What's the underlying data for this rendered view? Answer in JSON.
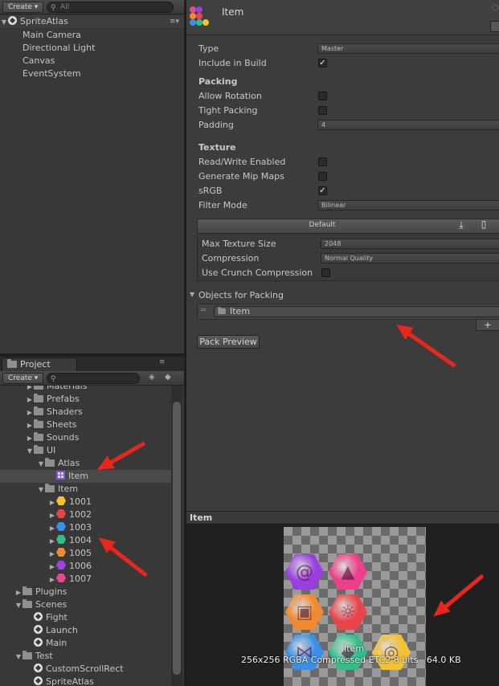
{
  "hierarchy": {
    "create_label": "Create",
    "search_placeholder": "All",
    "scene_name": "SpriteAtlas",
    "items": [
      "Main Camera",
      "Directional Light",
      "Canvas",
      "EventSystem"
    ]
  },
  "project": {
    "tab_label": "Project",
    "create_label": "Create",
    "tree": [
      {
        "label": "Materials",
        "icon": "folder-icon",
        "level": 1,
        "arrow": "collapsed"
      },
      {
        "label": "Prefabs",
        "icon": "folder-icon",
        "level": 1,
        "arrow": "collapsed"
      },
      {
        "label": "Shaders",
        "icon": "folder-icon",
        "level": 1,
        "arrow": "collapsed"
      },
      {
        "label": "Sheets",
        "icon": "folder-icon",
        "level": 1,
        "arrow": "collapsed"
      },
      {
        "label": "Sounds",
        "icon": "folder-icon",
        "level": 1,
        "arrow": "collapsed"
      },
      {
        "label": "UI",
        "icon": "folder-icon",
        "level": 1,
        "arrow": "expanded"
      },
      {
        "label": "Atlas",
        "icon": "folder-icon",
        "level": 2,
        "arrow": "expanded"
      },
      {
        "label": "Item",
        "icon": "sprite-atlas-icon",
        "level": 3,
        "arrow": "none",
        "selected": true
      },
      {
        "label": "Item",
        "icon": "folder-icon",
        "level": 2,
        "arrow": "expanded"
      },
      {
        "label": "1001",
        "icon": "gem-icon",
        "color": "#f2c230",
        "level": 3,
        "arrow": "collapsed"
      },
      {
        "label": "1002",
        "icon": "gem-icon",
        "color": "#e8454a",
        "level": 3,
        "arrow": "collapsed"
      },
      {
        "label": "1003",
        "icon": "gem-icon",
        "color": "#3a8fe8",
        "level": 3,
        "arrow": "collapsed"
      },
      {
        "label": "1004",
        "icon": "gem-icon",
        "color": "#2fc08a",
        "level": 3,
        "arrow": "collapsed"
      },
      {
        "label": "1005",
        "icon": "gem-icon",
        "color": "#f08a30",
        "level": 3,
        "arrow": "collapsed"
      },
      {
        "label": "1006",
        "icon": "gem-icon",
        "color": "#a040e0",
        "level": 3,
        "arrow": "collapsed"
      },
      {
        "label": "1007",
        "icon": "gem-icon",
        "color": "#e84890",
        "level": 3,
        "arrow": "collapsed"
      },
      {
        "label": "Plugins",
        "icon": "folder-icon",
        "level": 0,
        "arrow": "collapsed"
      },
      {
        "label": "Scenes",
        "icon": "folder-icon",
        "level": 0,
        "arrow": "expanded"
      },
      {
        "label": "Fight",
        "icon": "unity-scene-icon",
        "level": 1,
        "arrow": "none"
      },
      {
        "label": "Launch",
        "icon": "unity-scene-icon",
        "level": 1,
        "arrow": "none"
      },
      {
        "label": "Main",
        "icon": "unity-scene-icon",
        "level": 1,
        "arrow": "none"
      },
      {
        "label": "Test",
        "icon": "folder-icon",
        "level": 0,
        "arrow": "expanded"
      },
      {
        "label": "CustomScrollRect",
        "icon": "unity-scene-icon",
        "level": 1,
        "arrow": "none"
      },
      {
        "label": "SpriteAtlas",
        "icon": "unity-scene-icon",
        "level": 1,
        "arrow": "none"
      }
    ]
  },
  "inspector": {
    "title": "Item",
    "type_label": "Type",
    "type_value": "Master",
    "include_label": "Include in Build",
    "include_checked": true,
    "packing_header": "Packing",
    "allow_rotation_label": "Allow Rotation",
    "tight_packing_label": "Tight Packing",
    "padding_label": "Padding",
    "padding_value": "4",
    "texture_header": "Texture",
    "read_write_label": "Read/Write Enabled",
    "mip_maps_label": "Generate Mip Maps",
    "srgb_label": "sRGB",
    "srgb_checked": true,
    "filter_mode_label": "Filter Mode",
    "filter_mode_value": "Bilinear",
    "platform_tab": "Default",
    "max_size_label": "Max Texture Size",
    "max_size_value": "2048",
    "compression_label": "Compression",
    "compression_value": "Normal Quality",
    "crunch_label": "Use Crunch Compression",
    "objects_header": "Objects for Packing",
    "object_entry": "Item",
    "add_symbol": "+",
    "pack_preview_label": "Pack Preview"
  },
  "preview": {
    "header": "Item",
    "name_overlay": "Item",
    "info": "256x256 RGBA Compressed ETC2 8 bits   64.0 KB",
    "gems": [
      {
        "color": "#9a3ee0",
        "glyph": "@"
      },
      {
        "color": "#ee3f8a",
        "glyph": "▲"
      },
      {
        "color": "#f08a30",
        "glyph": "▣"
      },
      {
        "color": "#e8454a",
        "glyph": "☼"
      },
      {
        "color": "#3a8fe8",
        "glyph": "⋈"
      },
      {
        "color": "#2fc08a",
        "glyph": "◆"
      },
      {
        "color": "#f2c230",
        "glyph": "◎"
      }
    ]
  }
}
